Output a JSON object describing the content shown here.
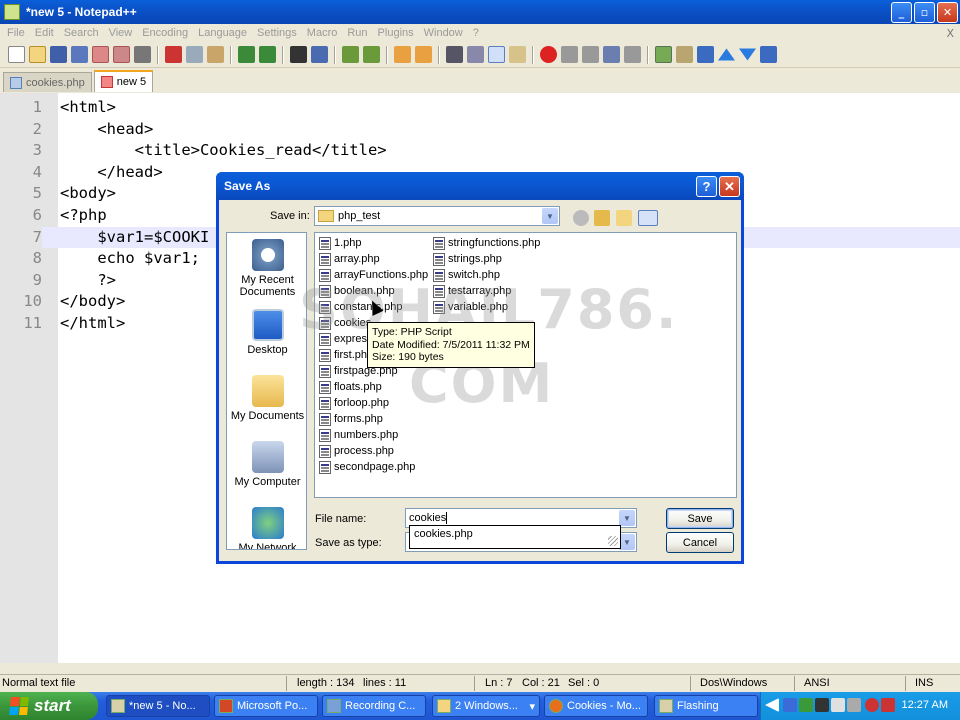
{
  "window": {
    "title": "*new  5 - Notepad++"
  },
  "menu": [
    "File",
    "Edit",
    "Search",
    "View",
    "Encoding",
    "Language",
    "Settings",
    "Macro",
    "Run",
    "Plugins",
    "Window",
    "?"
  ],
  "menu_close": "X",
  "tabs": [
    {
      "label": "cookies.php",
      "active": false
    },
    {
      "label": "new  5",
      "active": true
    }
  ],
  "editor": {
    "current_line": 7,
    "lines": [
      {
        "num": "1",
        "code": "<html>"
      },
      {
        "num": "2",
        "code": "    <head>"
      },
      {
        "num": "3",
        "code": "        <title>Cookies_read</title>"
      },
      {
        "num": "4",
        "code": "    </head>"
      },
      {
        "num": "5",
        "code": "<body>"
      },
      {
        "num": "6",
        "code": "<?php"
      },
      {
        "num": "7",
        "code": "    $var1=$COOKI"
      },
      {
        "num": "8",
        "code": "    echo $var1;"
      },
      {
        "num": "9",
        "code": "    ?>"
      },
      {
        "num": "10",
        "code": "</body>"
      },
      {
        "num": "11",
        "code": "</html>"
      }
    ]
  },
  "statusbar": {
    "type": "Normal text file",
    "length": "length : 134",
    "lines": "lines : 11",
    "ln": "Ln : 7",
    "col": "Col : 21",
    "sel": "Sel : 0",
    "eol": "Dos\\Windows",
    "encoding": "ANSI",
    "mode": "INS"
  },
  "dialog": {
    "title": "Save As",
    "help_glyph": "?",
    "close_glyph": "✕",
    "save_in_label": "Save in:",
    "save_in_value": "php_test",
    "places": [
      "My Recent Documents",
      "Desktop",
      "My Documents",
      "My Computer",
      "My Network"
    ],
    "files_col1": [
      "1.php",
      "array.php",
      "arrayFunctions.php",
      "boolean.php",
      "constants.php",
      "cookies",
      "express",
      "first.php",
      "firstpage.php",
      "floats.php",
      "forloop.php",
      "forms.php",
      "numbers.php",
      "process.php",
      "secondpage.php"
    ],
    "files_col2": [
      "stringfunctions.php",
      "strings.php",
      "switch.php",
      "testarray.php",
      "variable.php"
    ],
    "tooltip": {
      "type": "Type: PHP Script",
      "modified": "Date Modified: 7/5/2011 11:32 PM",
      "size": "Size: 190 bytes"
    },
    "file_name_label": "File name:",
    "file_name_value": "cookies",
    "save_as_type_label": "Save as type:",
    "autocomplete": "cookies.php",
    "save_button": "Save",
    "cancel_button": "Cancel"
  },
  "watermark": {
    "line1": "SOHAIL786.",
    "line2": "COM"
  },
  "taskbar": {
    "start": "start",
    "tasks": [
      "*new  5 - No...",
      "Microsoft Po...",
      "Recording C...",
      "2 Windows...",
      "Cookies - Mo...",
      "Flashing"
    ],
    "clock": "12:27 AM"
  }
}
